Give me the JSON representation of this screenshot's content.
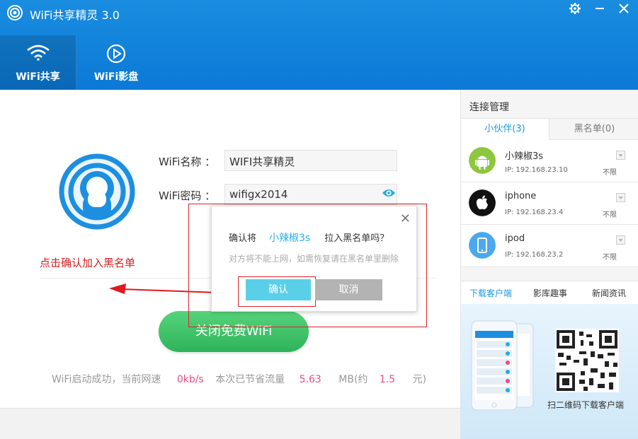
{
  "app": {
    "title": "WiFi共享精灵 3.0"
  },
  "nav": {
    "tabs": [
      {
        "label": "WiFi共享"
      },
      {
        "label": "WiFi影盘"
      }
    ]
  },
  "form": {
    "name_label": "WiFi名称 ：",
    "name_value": "WIFI共享精灵",
    "password_label": "WiFi密码 ：",
    "password_value": "wifigx2014"
  },
  "annotation": {
    "hint": "点击确认加入黑名单"
  },
  "main_button": {
    "label": "关闭免费WiFi"
  },
  "status": {
    "prefix": "WiFi启动成功，当前网速",
    "speed": "0kb/s",
    "saved_label": "本次已节省流量",
    "saved_value": "5.63",
    "unit": "MB(约",
    "money": "1.5",
    "money_unit": "元)"
  },
  "dialog": {
    "question_prefix": "确认将",
    "device_name": "小辣椒3s",
    "question_suffix": "拉入黑名单吗？",
    "subtext": "对方将不能上网，如需恢复请在黑名单里删除",
    "ok_label": "确认",
    "cancel_label": "取消",
    "close_icon": "close-icon"
  },
  "panel": {
    "title": "连接管理",
    "tabs": [
      {
        "label": "小伙伴(3)"
      },
      {
        "label": "黑名单(0)"
      }
    ],
    "devices": [
      {
        "name": "小辣椒3s",
        "ip": "IP: 192.168.23.10",
        "limit": "不限",
        "icon": "android-icon"
      },
      {
        "name": "iphone",
        "ip": "IP: 192.168.23.4",
        "limit": "不限",
        "icon": "apple-icon"
      },
      {
        "name": "ipod",
        "ip": "IP: 192.168.23.2",
        "limit": "不限",
        "icon": "phone-icon"
      }
    ],
    "bottom_tabs": [
      {
        "label": "下载客户端"
      },
      {
        "label": "影库趣事"
      },
      {
        "label": "新闻资讯"
      }
    ],
    "promo_caption": "扫二维码下载客户端"
  },
  "colors": {
    "brand_blue": "#1a8de0",
    "accent_green": "#3cc065",
    "alert_red": "#d8232a",
    "link_blue": "#2bb0e8"
  }
}
